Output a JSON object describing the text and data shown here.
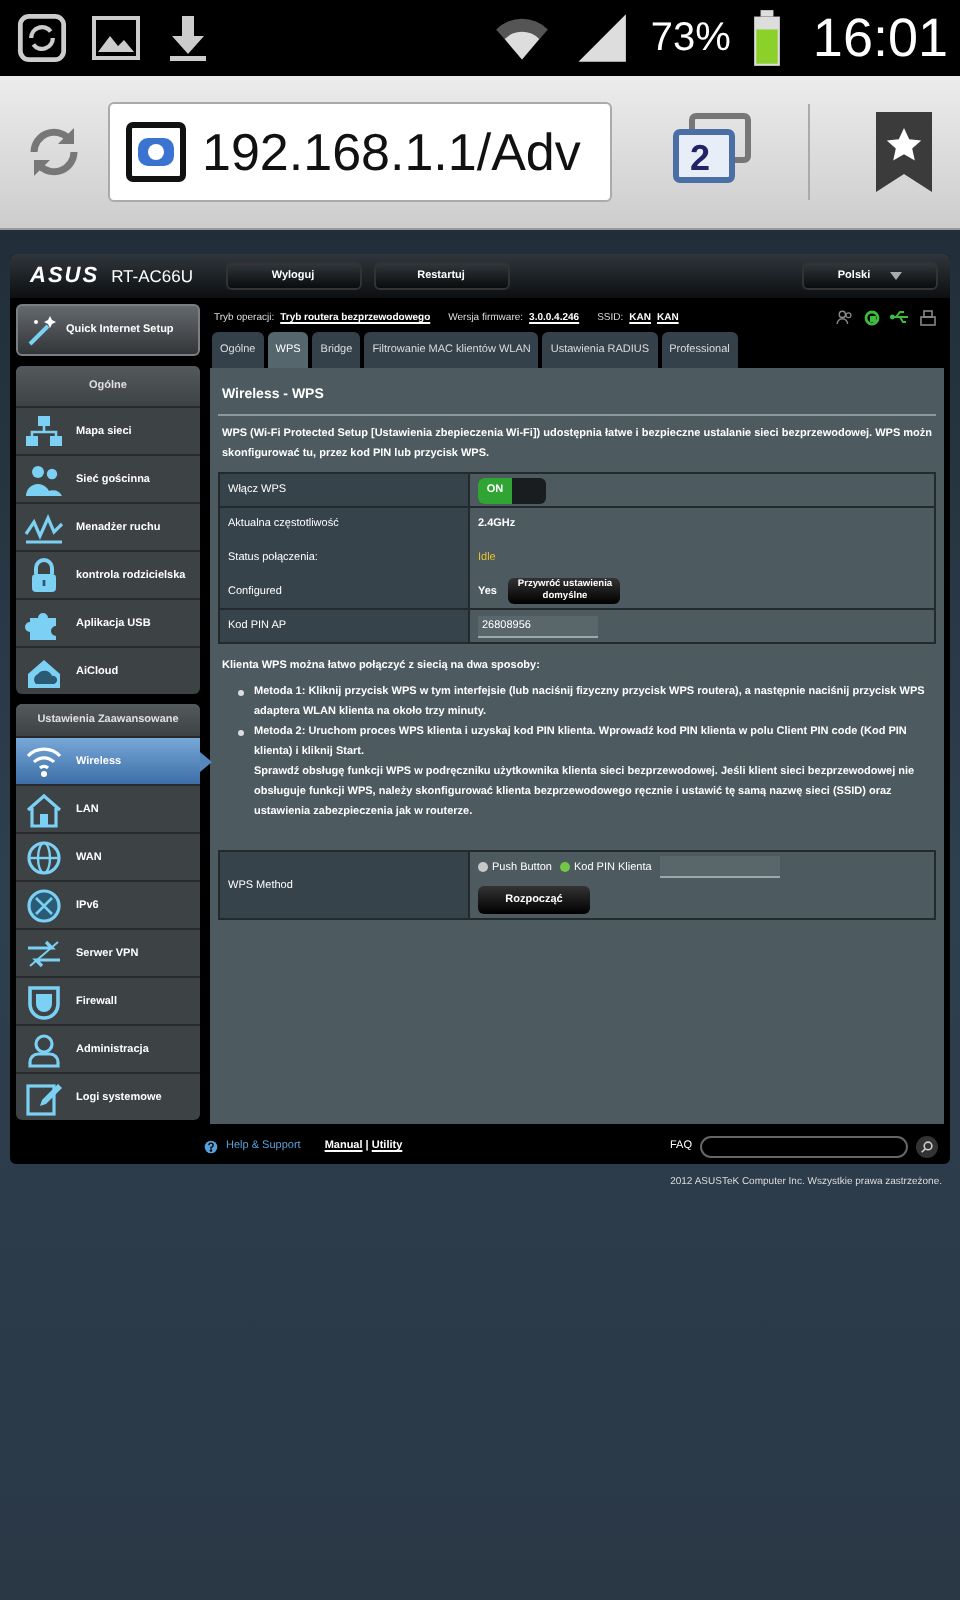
{
  "status_bar": {
    "battery": "73%",
    "time": "16:01"
  },
  "browser": {
    "url": "192.168.1.1/Adv",
    "tab_count": "2"
  },
  "router": {
    "logo": "ASUS",
    "model": "RT-AC66U",
    "buttons": [
      "Wyloguj",
      "Restartuj"
    ],
    "language": "Polski",
    "quick_setup": "Quick Internet Setup",
    "sections": [
      {
        "title": "Ogólne",
        "items": [
          {
            "label": "Mapa sieci",
            "selected": false
          },
          {
            "label": "Sieć gościnna",
            "selected": false
          },
          {
            "label": "Menadżer ruchu",
            "selected": false
          },
          {
            "label": "kontrola rodzicielska",
            "selected": false
          },
          {
            "label": "Aplikacja USB",
            "selected": false
          },
          {
            "label": "AiCloud",
            "selected": false
          }
        ]
      },
      {
        "title": "Ustawienia Zaawansowane",
        "items": [
          {
            "label": "Wireless",
            "selected": true
          },
          {
            "label": "LAN",
            "selected": false
          },
          {
            "label": "WAN",
            "selected": false
          },
          {
            "label": "IPv6",
            "selected": false
          },
          {
            "label": "Serwer VPN",
            "selected": false
          },
          {
            "label": "Firewall",
            "selected": false
          },
          {
            "label": "Administracja",
            "selected": false
          },
          {
            "label": "Logi systemowe",
            "selected": false
          }
        ]
      }
    ],
    "info": [
      {
        "label": "Tryb operacji:",
        "values": [
          "Tryb routera bezprzewodowego"
        ]
      },
      {
        "label": "Wersja firmware:",
        "values": [
          "3.0.0.4.246"
        ]
      },
      {
        "label": "SSID:",
        "values": [
          "KAN",
          "KAN"
        ]
      }
    ],
    "tabs": [
      {
        "label": "Ogólne",
        "selected": false
      },
      {
        "label": "WPS",
        "selected": true
      },
      {
        "label": "Bridge",
        "selected": false
      },
      {
        "label": "Filtrowanie MAC klientów WLAN",
        "selected": false
      },
      {
        "label": "Ustawienia RADIUS",
        "selected": false
      },
      {
        "label": "Professional",
        "selected": false
      }
    ],
    "panel": {
      "title": "Wireless - WPS",
      "description": "WPS (Wi-Fi Protected Setup [Ustawienia zbepieczenia Wi-Fi]) udostępnia łatwe i bezpieczne ustalanie sieci bezprzewodowej. WPS możn skonfigurować tu, przez kod PIN lub przycisk WPS.",
      "settings": [
        {
          "kind": "toggle",
          "label": "Włącz WPS",
          "value": "ON",
          "on": true
        },
        {
          "kind": "text",
          "label": "Aktualna częstotliwość",
          "value": "2.4GHz"
        },
        {
          "kind": "status",
          "label": "Status połączenia:",
          "value": "Idle"
        },
        {
          "kind": "configured",
          "label": "Configured",
          "value": "Yes",
          "button": "Przywróć ustawienia domyślne"
        },
        {
          "kind": "input",
          "label": "Kod PIN AP",
          "value": "26808956"
        }
      ],
      "intro": "Klienta WPS można łatwo połączyć z siecią na dwa sposoby:",
      "methods": [
        "Metoda 1: Kliknij przycisk WPS w tym interfejsie (lub naciśnij fizyczny przycisk WPS routera), a następnie naciśnij przycisk WPS adaptera WLAN klienta na około trzy minuty.",
        "Metoda 2: Uruchom proces WPS klienta i uzyskaj kod PIN klienta. Wprowadź kod PIN klienta w polu Client PIN code (Kod PIN klienta) i kliknij Start."
      ],
      "note": "Sprawdź obsługę funkcji WPS w podręczniku użytkownika klienta sieci bezprzewodowej. Jeśli klient sieci bezprzewodowej nie obsługuje funkcji WPS, należy skonfigurować klienta bezprzewodowego ręcznie i ustawić tę samą nazwę sieci (SSID) oraz ustawienia zabezpieczenia jak w routerze.",
      "wps_method": {
        "label": "WPS Method",
        "options": [
          {
            "label": "Push Button",
            "selected": false
          },
          {
            "label": "Kod PIN Klienta",
            "selected": true
          }
        ],
        "start_button": "Rozpocząć"
      }
    },
    "footer": {
      "help": "Help & Support",
      "links": [
        "Manual",
        "Utility"
      ],
      "link_separator": "|",
      "faq": "FAQ"
    },
    "copyright": "2012 ASUSTeK Computer Inc. Wszystkie prawa zastrzeżone."
  }
}
